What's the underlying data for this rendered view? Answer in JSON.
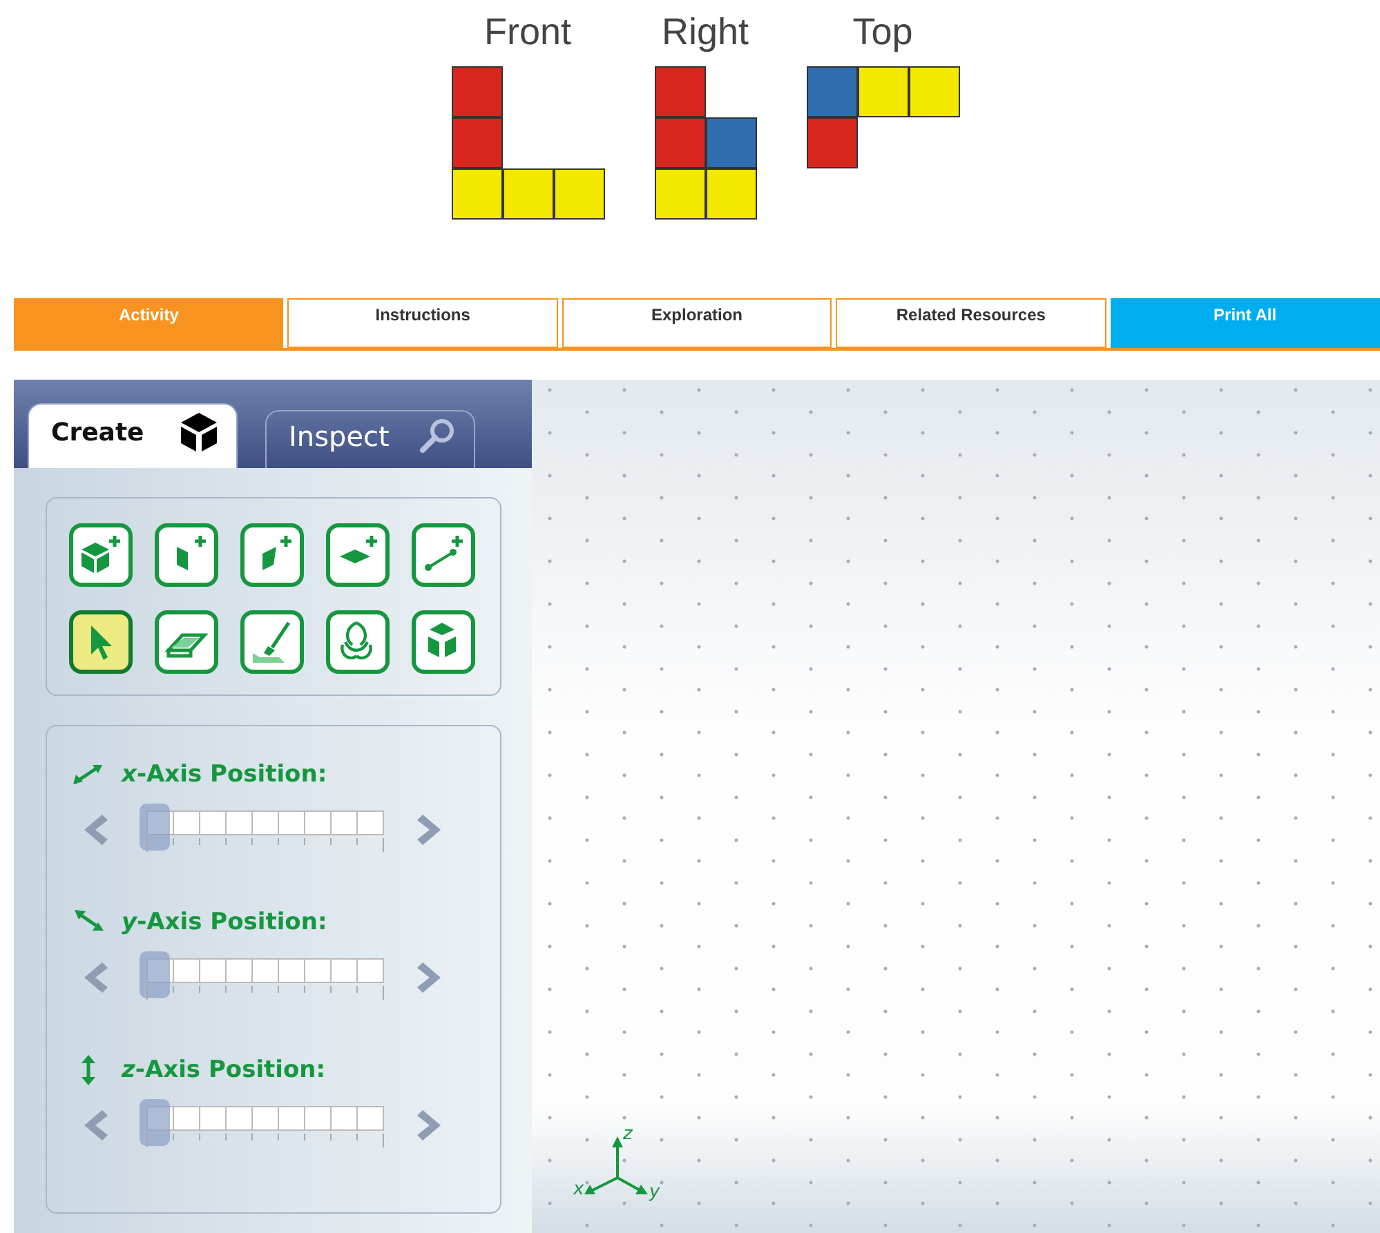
{
  "views": [
    {
      "label": "Front",
      "rows": [
        [
          {
            "kind": "block",
            "color": "#d8261e"
          },
          {
            "kind": "gap"
          },
          {
            "kind": "gap"
          }
        ],
        [
          {
            "kind": "block",
            "color": "#d8261e"
          },
          {
            "kind": "gap"
          },
          {
            "kind": "gap"
          }
        ],
        [
          {
            "kind": "block",
            "color": "#f5e800"
          },
          {
            "kind": "block",
            "color": "#f5e800"
          },
          {
            "kind": "block",
            "color": "#f5e800"
          }
        ]
      ]
    },
    {
      "label": "Right",
      "rows": [
        [
          {
            "kind": "block",
            "color": "#d8261e"
          },
          {
            "kind": "gap"
          }
        ],
        [
          {
            "kind": "block",
            "color": "#d8261e"
          },
          {
            "kind": "block",
            "color": "#2f6db0"
          }
        ],
        [
          {
            "kind": "block",
            "color": "#f5e800"
          },
          {
            "kind": "block",
            "color": "#f5e800"
          }
        ]
      ]
    },
    {
      "label": "Top",
      "rows": [
        [
          {
            "kind": "block",
            "color": "#2f6db0"
          },
          {
            "kind": "block",
            "color": "#f5e800"
          },
          {
            "kind": "block",
            "color": "#f5e800"
          }
        ],
        [
          {
            "kind": "block",
            "color": "#d8261e"
          },
          {
            "kind": "gap"
          },
          {
            "kind": "gap"
          }
        ]
      ]
    }
  ],
  "nav": [
    {
      "label": "Activity",
      "kind": "tab",
      "selected": true
    },
    {
      "label": "Instructions",
      "kind": "tab",
      "selected": false
    },
    {
      "label": "Exploration",
      "kind": "tab",
      "selected": false
    },
    {
      "label": "Related Resources",
      "kind": "tab",
      "selected": false
    },
    {
      "label": "Print All",
      "kind": "print",
      "selected": false
    }
  ],
  "tabs": [
    {
      "label": "Create",
      "selected": true,
      "kind": "cube"
    },
    {
      "label": "Inspect",
      "selected": false,
      "kind": "search"
    }
  ],
  "tools": [
    {
      "kind": "add-cube",
      "selected": false
    },
    {
      "kind": "add-side",
      "selected": false
    },
    {
      "kind": "add-front",
      "selected": false
    },
    {
      "kind": "add-top",
      "selected": false
    },
    {
      "kind": "add-edge",
      "selected": false
    },
    {
      "kind": "pointer",
      "selected": true
    },
    {
      "kind": "eraser",
      "selected": false
    },
    {
      "kind": "paint",
      "selected": false
    },
    {
      "kind": "rotate",
      "selected": false
    },
    {
      "kind": "views",
      "selected": false
    }
  ],
  "sliders": [
    {
      "axis": "x",
      "label": "-Axis Position:",
      "kind": "x",
      "level": 0
    },
    {
      "axis": "y",
      "label": "-Axis Position:",
      "kind": "y",
      "level": 0
    },
    {
      "axis": "z",
      "label": "-Axis Position:",
      "kind": "z",
      "level": 0
    }
  ],
  "triad": {
    "x": "x",
    "y": "y",
    "z": "z"
  }
}
